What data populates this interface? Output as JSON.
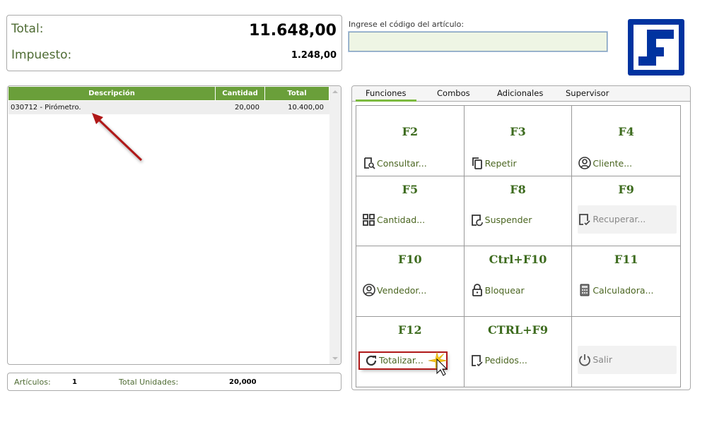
{
  "totals": {
    "total_label": "Total:",
    "total_value": "11.648,00",
    "tax_label": "Impuesto:",
    "tax_value": "1.248,00"
  },
  "code": {
    "label": "Ingrese el código del artículo:",
    "value": ""
  },
  "grid": {
    "headers": [
      "Descripción",
      "Cantidad",
      "Total"
    ],
    "rows": [
      {
        "description": "030712 - Pirómetro.",
        "quantity": "20,000",
        "total": "10.400,00"
      }
    ]
  },
  "footer": {
    "items_label": "Artículos:",
    "items_value": "1",
    "units_label": "Total Unidades:",
    "units_value": "20,000"
  },
  "tabs": [
    "Funciones",
    "Combos",
    "Adicionales",
    "Supervisor"
  ],
  "functions": [
    {
      "key": "F2",
      "label": "Consultar...",
      "icon": "document-search-icon"
    },
    {
      "key": "F3",
      "label": "Repetir",
      "icon": "copy-icon"
    },
    {
      "key": "F4",
      "label": "Cliente...",
      "icon": "user-circle-icon"
    },
    {
      "key": "F5",
      "label": "Cantidad...",
      "icon": "grid-icon"
    },
    {
      "key": "F8",
      "label": "Suspender",
      "icon": "document-refresh-icon"
    },
    {
      "key": "F9",
      "label": "Recuperar...",
      "icon": "document-check-icon"
    },
    {
      "key": "F10",
      "label": "Vendedor...",
      "icon": "user-circle-icon"
    },
    {
      "key": "Ctrl+F10",
      "label": "Bloquear",
      "icon": "lock-icon"
    },
    {
      "key": "F11",
      "label": "Calculadora...",
      "icon": "calculator-icon"
    },
    {
      "key": "F12",
      "label": "Totalizar...",
      "icon": "refresh-icon"
    },
    {
      "key": "CTRL+F9",
      "label": "Pedidos...",
      "icon": "document-check-icon"
    },
    {
      "key": "",
      "label": "Salir",
      "icon": "power-icon"
    }
  ],
  "colors": {
    "accent": "#6a9f3a",
    "logo": "#0033a0",
    "highlight": "#b01818"
  }
}
